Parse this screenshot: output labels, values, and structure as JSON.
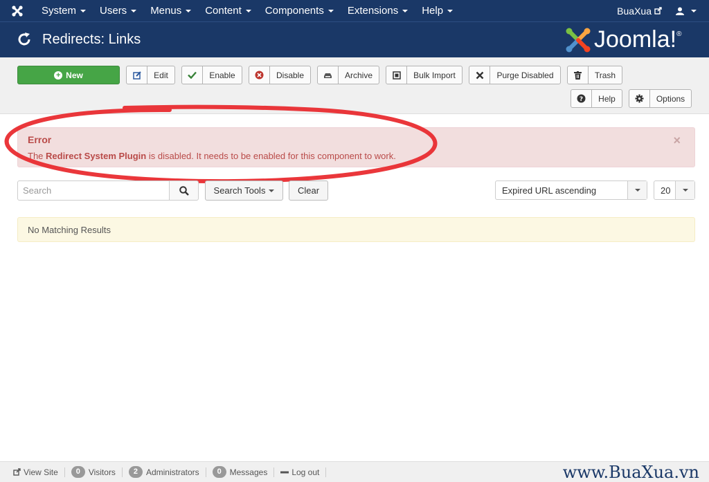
{
  "navbar": {
    "menu": [
      {
        "label": "System"
      },
      {
        "label": "Users"
      },
      {
        "label": "Menus"
      },
      {
        "label": "Content"
      },
      {
        "label": "Components"
      },
      {
        "label": "Extensions"
      },
      {
        "label": "Help"
      }
    ],
    "site_name": "BuaXua"
  },
  "header": {
    "title": "Redirects: Links",
    "logo_text": "Joomla!",
    "logo_mark": "®"
  },
  "toolbar": {
    "new_label": "New",
    "edit_label": "Edit",
    "enable_label": "Enable",
    "disable_label": "Disable",
    "archive_label": "Archive",
    "bulk_import_label": "Bulk Import",
    "purge_disabled_label": "Purge Disabled",
    "trash_label": "Trash",
    "help_label": "Help",
    "options_label": "Options"
  },
  "error": {
    "heading": "Error",
    "prefix": "The ",
    "emphasis": "Redirect System Plugin",
    "suffix": " is disabled. It needs to be enabled for this component to work.",
    "close": "×"
  },
  "filters": {
    "search_placeholder": "Search",
    "search_tools_label": "Search Tools",
    "clear_label": "Clear",
    "ordering": "Expired URL ascending",
    "limit": "20"
  },
  "results": {
    "message": "No Matching Results"
  },
  "status": {
    "view_site": "View Site",
    "visitors_count": "0",
    "visitors_label": "Visitors",
    "admins_count": "2",
    "admins_label": "Administrators",
    "messages_count": "0",
    "messages_label": "Messages",
    "logout": "Log out"
  },
  "watermark": "www.BuaXua.vn",
  "colors": {
    "navbar": "#1a3867",
    "new_button": "#46a546",
    "error_bg": "#f2dede",
    "error_text": "#b94a48",
    "info_bg": "#fcf8e3",
    "annotation": "#e8262a"
  }
}
